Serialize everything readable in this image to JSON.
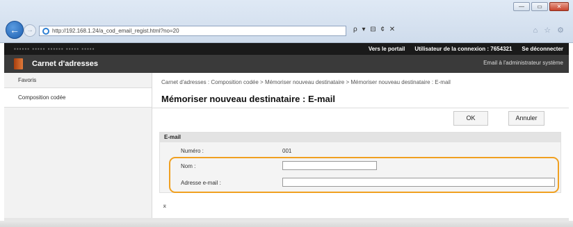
{
  "browser": {
    "url": "http://192.168.1.24/a_cod_email_regist.html?no=20",
    "window_buttons": [
      "—",
      "▭",
      "✕"
    ],
    "back_icon": "back-arrow-icon",
    "forward_icon": "forward-arrow-icon",
    "toolbar_text": "ρ ▾ ⊟ ¢ ✕",
    "favorites_text": "⌂ ☆ ⚙"
  },
  "topbar": {
    "device_name": "▪▪▪▪▪▪   ▪▪▪▪▪ ▪▪▪▪▪▪  ▪▪▪▪▪ ▪▪▪▪▪",
    "portal": "Vers le portail",
    "login_user": "Utilisateur de la connexion :  7654321",
    "logout": "Se déconnecter"
  },
  "titlebar": {
    "title": "Carnet d'adresses",
    "email_admin": "Email à l'administrateur système"
  },
  "sidebar": {
    "items": [
      {
        "label": "Favoris"
      },
      {
        "label": "Composition codée"
      }
    ]
  },
  "main": {
    "breadcrumb": "Carnet d'adresses : Composition codée > Mémoriser nouveau destinataire > Mémoriser nouveau destinataire : E-mail",
    "heading": "Mémoriser nouveau destinataire : E-mail",
    "ok_label": "OK",
    "cancel_label": "Annuler",
    "section_title": "E-mail",
    "number_label": "Numéro :",
    "number_value": "001",
    "name_label": "Nom :",
    "name_value": "",
    "email_label": "Adresse e-mail :",
    "email_value": "",
    "to_top": "⌅"
  },
  "colors": {
    "highlight": "#f0a020",
    "titlebar": "#3a3a3a",
    "topbar": "#1a1a1a"
  }
}
